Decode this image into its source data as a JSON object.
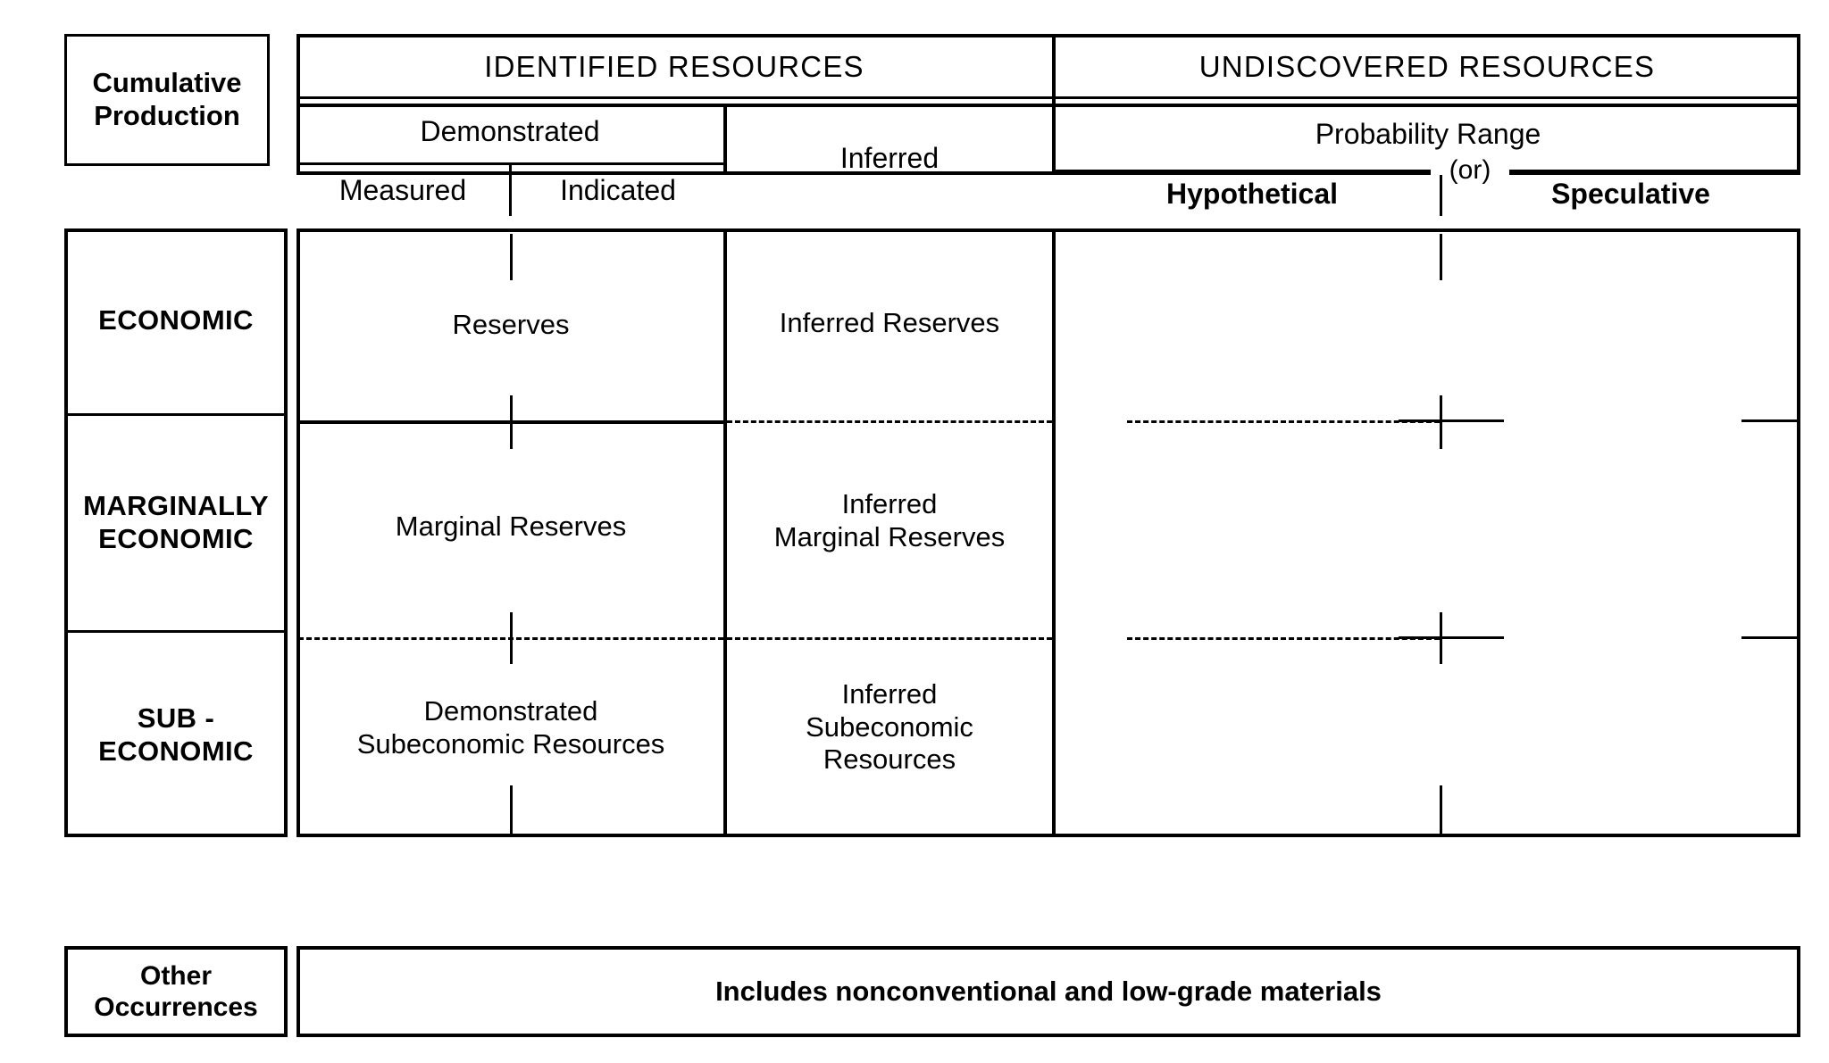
{
  "diagram": {
    "title_visible": false,
    "left_header_box": {
      "line1": "Cumulative",
      "line2": "Production"
    },
    "top_headers": [
      {
        "label": "IDENTIFIED RESOURCES"
      },
      {
        "label": "UNDISCOVERED RESOURCES"
      }
    ],
    "sub_headers": {
      "demonstrated": "Demonstrated",
      "measured": "Measured",
      "indicated": "Indicated",
      "inferred": "Inferred",
      "probability_range": "Probability Range",
      "or": "(or)",
      "hypothetical": "Hypothetical",
      "speculative": "Speculative"
    },
    "row_labels": [
      {
        "line1": "ECONOMIC",
        "line2": ""
      },
      {
        "line1": "MARGINALLY",
        "line2": "ECONOMIC"
      },
      {
        "line1": "SUB -",
        "line2": "ECONOMIC"
      }
    ],
    "cells": {
      "economic_demonstrated": "Reserves",
      "economic_inferred": "Inferred  Reserves",
      "marginal_demonstrated": "Marginal Reserves",
      "marginal_inferred_l1": "Inferred",
      "marginal_inferred_l2": "Marginal Reserves",
      "sub_demonstrated_l1": "Demonstrated",
      "sub_demonstrated_l2": "Subeconomic Resources",
      "sub_inferred_l1": "Inferred",
      "sub_inferred_l2": "Subeconomic",
      "sub_inferred_l3": "Resources"
    },
    "footer": {
      "label_l1": "Other",
      "label_l2": "Occurrences",
      "text": "Includes nonconventional and low-grade materials"
    },
    "colors": {
      "ink": "#000000",
      "paper": "#ffffff"
    }
  }
}
